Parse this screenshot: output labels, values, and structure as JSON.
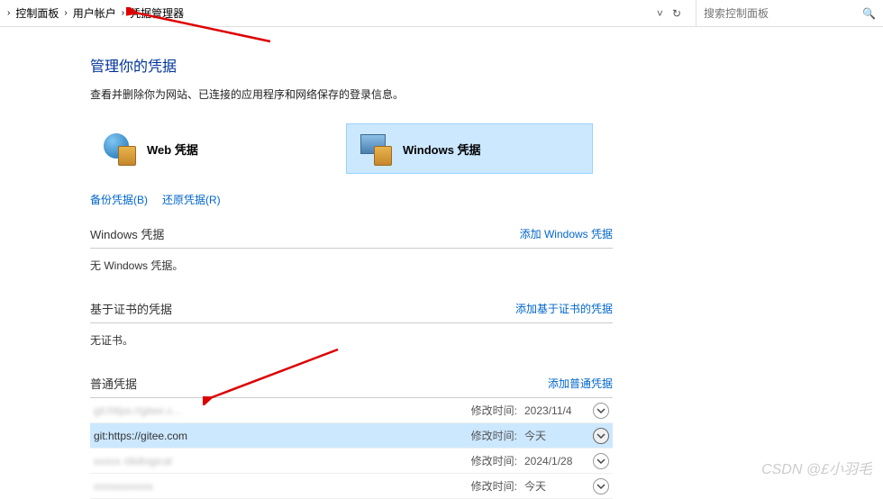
{
  "breadcrumb": {
    "items": [
      "控制面板",
      "用户帐户",
      "凭据管理器"
    ]
  },
  "search": {
    "placeholder": "搜索控制面板"
  },
  "page": {
    "title": "管理你的凭据",
    "subtitle": "查看并删除你为网站、已连接的应用程序和网络保存的登录信息。"
  },
  "tabs": {
    "web": {
      "label": "Web 凭据"
    },
    "windows": {
      "label": "Windows 凭据"
    }
  },
  "actions": {
    "backup": "备份凭据(B)",
    "restore": "还原凭据(R)"
  },
  "sections": {
    "windows": {
      "title": "Windows 凭据",
      "add": "添加 Windows 凭据",
      "empty": "无 Windows 凭据。"
    },
    "cert": {
      "title": "基于证书的凭据",
      "add": "添加基于证书的凭据",
      "empty": "无证书。"
    },
    "generic": {
      "title": "普通凭据",
      "add": "添加普通凭据",
      "mod_label": "修改时间:",
      "items": [
        {
          "name": "git:https://gitee.c...",
          "date": "2023/11/4",
          "blurred": true,
          "highlighted": false
        },
        {
          "name": "git:https://gitee.com",
          "date": "今天",
          "blurred": false,
          "highlighted": true
        },
        {
          "name": "xxxxx /didlogical",
          "date": "2024/1/28",
          "blurred": true,
          "highlighted": false
        },
        {
          "name": "xxxxxxxxxxx",
          "date": "今天",
          "blurred": true,
          "highlighted": false
        }
      ]
    }
  },
  "watermark": "CSDN @£小羽毛"
}
